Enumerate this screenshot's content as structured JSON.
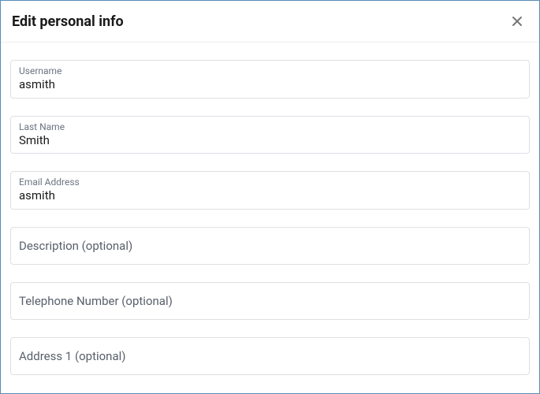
{
  "header": {
    "title": "Edit personal info"
  },
  "fields": {
    "username": {
      "label": "Username",
      "value": "asmith"
    },
    "lastName": {
      "label": "Last Name",
      "value": "Smith"
    },
    "email": {
      "label": "Email Address",
      "value": "asmith"
    },
    "description": {
      "label": "Description (optional)",
      "value": ""
    },
    "telephone": {
      "label": "Telephone Number (optional)",
      "value": ""
    },
    "address1": {
      "label": "Address 1 (optional)",
      "value": ""
    }
  }
}
